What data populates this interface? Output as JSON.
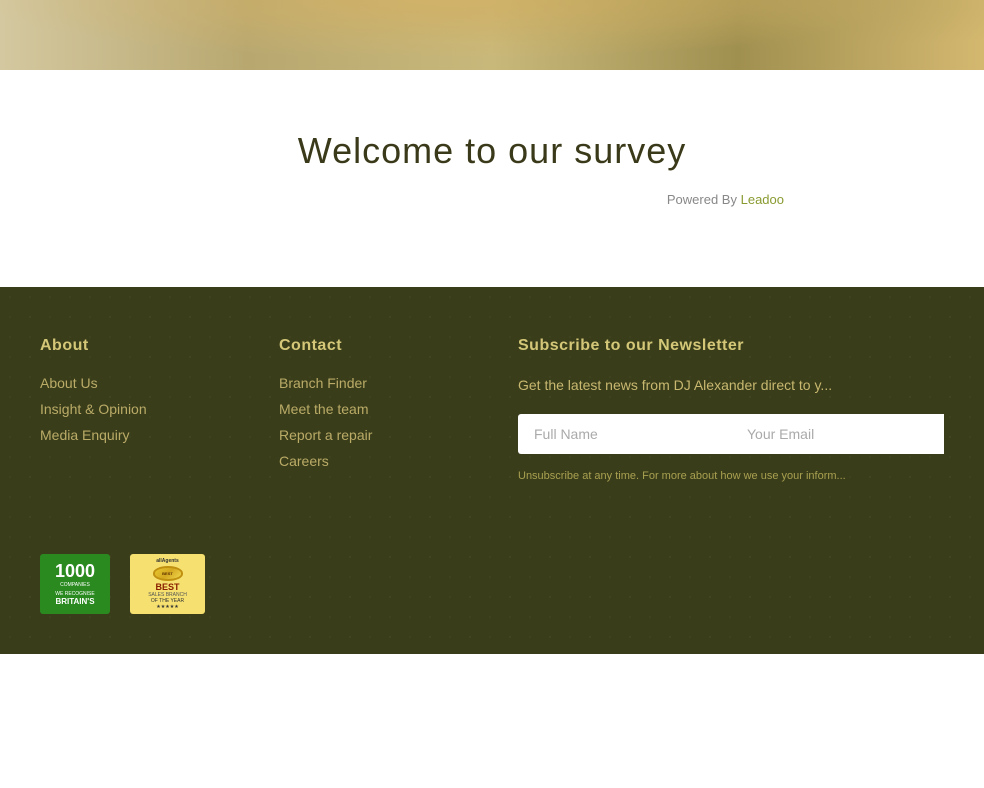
{
  "hero": {
    "alt": "Hero background image with person"
  },
  "survey": {
    "title": "Welcome to our survey",
    "powered_by_label": "Powered By",
    "powered_by_link": "Leadoo"
  },
  "footer": {
    "about": {
      "heading": "About",
      "links": [
        {
          "label": "About Us",
          "href": "#"
        },
        {
          "label": "Insight & Opinion",
          "href": "#"
        },
        {
          "label": "Media Enquiry",
          "href": "#"
        }
      ]
    },
    "contact": {
      "heading": "Contact",
      "links": [
        {
          "label": "Branch Finder",
          "href": "#"
        },
        {
          "label": "Meet the team",
          "href": "#"
        },
        {
          "label": "Report a repair",
          "href": "#"
        },
        {
          "label": "Careers",
          "href": "#"
        }
      ]
    },
    "newsletter": {
      "heading": "Subscribe to our Newsletter",
      "description": "Get the latest news from DJ Alexander direct to y...",
      "full_name_placeholder": "Full Name",
      "email_placeholder": "Your Email",
      "note": "Unsubscribe at any time. For more about how we use your inform..."
    },
    "badge1": {
      "number": "1000",
      "line1": "COMPANIES",
      "line2": "WE RECOGNISE",
      "line3": "BRITAIN'S"
    },
    "badge2": {
      "top": "allAgents",
      "best": "BEST",
      "branch": "SALES BRANCH",
      "of_year": "OF THE YEAR",
      "bottom": "★★★★★"
    }
  }
}
